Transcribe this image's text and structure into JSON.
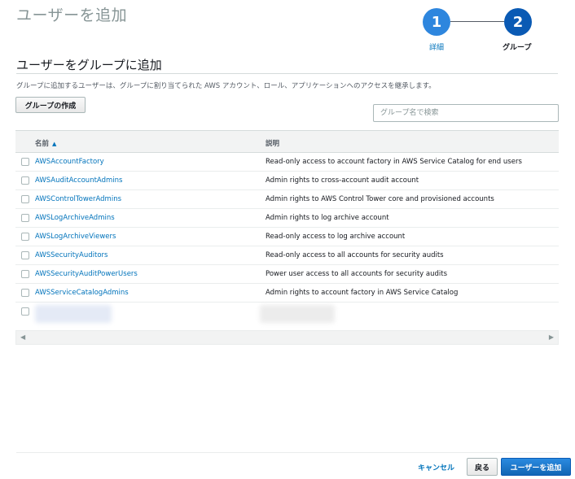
{
  "page": {
    "title": "ユーザーを追加"
  },
  "stepper": {
    "steps": [
      {
        "number": "1",
        "label": "詳細"
      },
      {
        "number": "2",
        "label": "グループ"
      }
    ]
  },
  "section": {
    "title": "ユーザーをグループに追加",
    "description": "グループに追加するユーザーは、グループに割り当てられた AWS アカウント、ロール、アプリケーションへのアクセスを継承します。"
  },
  "toolbar": {
    "create_group_label": "グループの作成",
    "search_placeholder": "グループ名で検索"
  },
  "table": {
    "columns": {
      "name": "名前",
      "description": "説明"
    },
    "sort_icon": "sort-ascending-icon",
    "rows": [
      {
        "name": "AWSAccountFactory",
        "description": "Read-only access to account factory in AWS Service Catalog for end users"
      },
      {
        "name": "AWSAuditAccountAdmins",
        "description": "Admin rights to cross-account audit account"
      },
      {
        "name": "AWSControlTowerAdmins",
        "description": "Admin rights to AWS Control Tower core and provisioned accounts"
      },
      {
        "name": "AWSLogArchiveAdmins",
        "description": "Admin rights to log archive account"
      },
      {
        "name": "AWSLogArchiveViewers",
        "description": "Read-only access to log archive account"
      },
      {
        "name": "AWSSecurityAuditors",
        "description": "Read-only access to all accounts for security audits"
      },
      {
        "name": "AWSSecurityAuditPowerUsers",
        "description": "Power user access to all accounts for security audits"
      },
      {
        "name": "AWSServiceCatalogAdmins",
        "description": "Admin rights to account factory in AWS Service Catalog"
      }
    ]
  },
  "footer": {
    "cancel_label": "キャンセル",
    "back_label": "戻る",
    "add_user_label": "ユーザーを追加"
  },
  "colors": {
    "link": "#0073bb",
    "step_active": "#0a5ab4",
    "step_done": "#2e86de",
    "primary_button": "#1266b4"
  }
}
